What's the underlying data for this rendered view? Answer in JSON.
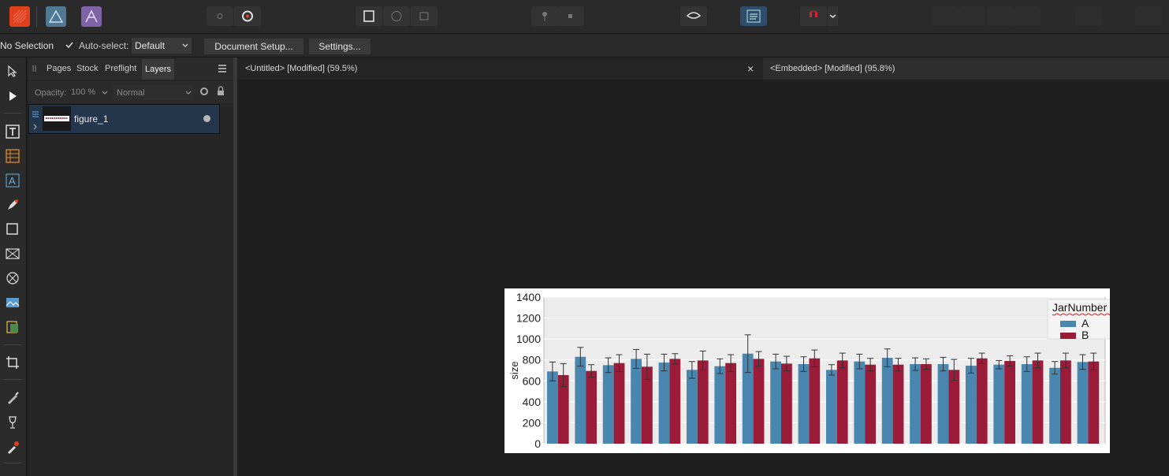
{
  "app": {
    "toolbar_icons": [
      "publisher-persona-icon",
      "designer-persona-icon",
      "photo-persona-icon",
      "place-icon",
      "settings-cog-icon",
      "spread-icon",
      "circle-icon",
      "square-icon",
      "pin-icon",
      "dot-icon",
      "preview-icon",
      "text-frame-icon",
      "snapping-magnet-icon",
      "dropdown-chevron-icon"
    ]
  },
  "context_bar": {
    "selection_label": "No Selection",
    "auto_select_label": "Auto-select:",
    "auto_select_checked": true,
    "auto_select_value": "Default",
    "document_setup_label": "Document Setup...",
    "settings_label": "Settings..."
  },
  "panel": {
    "tabs": [
      "Pages",
      "Stock",
      "Preflight",
      "Layers"
    ],
    "active_tab": "Layers",
    "opacity_label": "Opacity:",
    "opacity_value": "100 %",
    "blend_mode": "Normal",
    "layers": [
      {
        "name": "figure_1"
      }
    ]
  },
  "documents": {
    "tab1": "<Untitled> [Modified] (59.5%)",
    "tab1_close": "×",
    "tab2": "<Embedded> [Modified] (95.8%)"
  },
  "chart_data": {
    "type": "bar",
    "ylabel": "size",
    "xlabel": "",
    "ylim": [
      0,
      1400
    ],
    "yticks": [
      0,
      200,
      400,
      600,
      800,
      1000,
      1200,
      1400
    ],
    "grid": true,
    "legend": {
      "title": "JarNumber",
      "position": "top-right",
      "entries": [
        "A",
        "B"
      ]
    },
    "colors": {
      "A": "#4a87b0",
      "B": "#9b1c38",
      "plot_bg": "#ececec"
    },
    "series": [
      {
        "name": "A",
        "values": [
          690,
          830,
          750,
          810,
          775,
          705,
          740,
          860,
          785,
          760,
          705,
          785,
          820,
          760,
          760,
          745,
          755,
          760,
          725,
          780
        ],
        "errors": [
          90,
          90,
          70,
          90,
          80,
          80,
          70,
          180,
          70,
          70,
          50,
          70,
          85,
          60,
          65,
          70,
          40,
          70,
          60,
          70
        ]
      },
      {
        "name": "B",
        "values": [
          655,
          695,
          770,
          735,
          810,
          795,
          770,
          810,
          765,
          815,
          795,
          755,
          755,
          760,
          705,
          815,
          790,
          795,
          795,
          785
        ],
        "errors": [
          110,
          60,
          80,
          120,
          50,
          90,
          80,
          70,
          70,
          80,
          70,
          60,
          60,
          50,
          100,
          50,
          50,
          70,
          70,
          80
        ]
      }
    ]
  }
}
